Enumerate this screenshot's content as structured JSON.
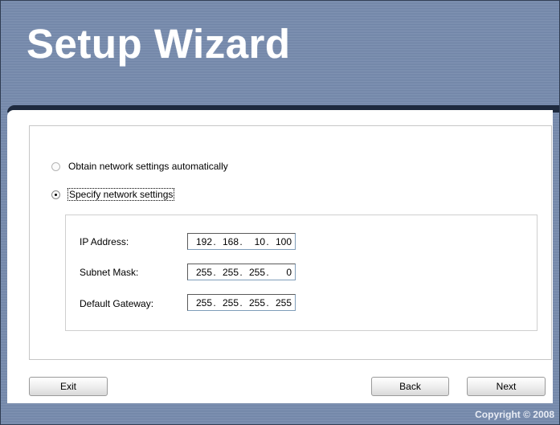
{
  "header": {
    "title": "Setup Wizard"
  },
  "options": [
    {
      "label": "Obtain network settings automatically",
      "selected": false
    },
    {
      "label": "Specify network settings",
      "selected": true
    }
  ],
  "fields": {
    "ip": {
      "label": "IP Address:",
      "octets": [
        "192",
        "168",
        "10",
        "100"
      ]
    },
    "subnet": {
      "label": "Subnet Mask:",
      "octets": [
        "255",
        "255",
        "255",
        "0"
      ]
    },
    "gateway": {
      "label": "Default Gateway:",
      "octets": [
        "255",
        "255",
        "255",
        "255"
      ]
    }
  },
  "buttons": {
    "exit": "Exit",
    "back": "Back",
    "next": "Next"
  },
  "footer": {
    "copyright": "Copyright © 2008"
  },
  "colors": {
    "background": "#7489ad",
    "bar": "#1e2a3e",
    "text_light": "#ffffff"
  }
}
